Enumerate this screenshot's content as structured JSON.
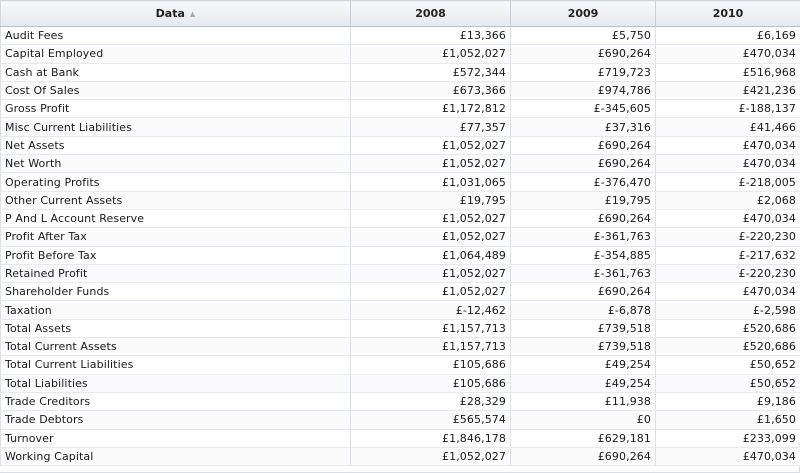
{
  "table": {
    "columns": [
      "Data",
      "2008",
      "2009",
      "2010"
    ],
    "sorted_column_icon": "sort-ascending-icon",
    "rows": [
      [
        "Audit Fees",
        "£13,366",
        "£5,750",
        "£6,169"
      ],
      [
        "Capital Employed",
        "£1,052,027",
        "£690,264",
        "£470,034"
      ],
      [
        "Cash at Bank",
        "£572,344",
        "£719,723",
        "£516,968"
      ],
      [
        "Cost Of Sales",
        "£673,366",
        "£974,786",
        "£421,236"
      ],
      [
        "Gross Profit",
        "£1,172,812",
        "£-345,605",
        "£-188,137"
      ],
      [
        "Misc Current Liabilities",
        "£77,357",
        "£37,316",
        "£41,466"
      ],
      [
        "Net Assets",
        "£1,052,027",
        "£690,264",
        "£470,034"
      ],
      [
        "Net Worth",
        "£1,052,027",
        "£690,264",
        "£470,034"
      ],
      [
        "Operating Profits",
        "£1,031,065",
        "£-376,470",
        "£-218,005"
      ],
      [
        "Other Current Assets",
        "£19,795",
        "£19,795",
        "£2,068"
      ],
      [
        "P And L Account Reserve",
        "£1,052,027",
        "£690,264",
        "£470,034"
      ],
      [
        "Profit After Tax",
        "£1,052,027",
        "£-361,763",
        "£-220,230"
      ],
      [
        "Profit Before Tax",
        "£1,064,489",
        "£-354,885",
        "£-217,632"
      ],
      [
        "Retained Profit",
        "£1,052,027",
        "£-361,763",
        "£-220,230"
      ],
      [
        "Shareholder Funds",
        "£1,052,027",
        "£690,264",
        "£470,034"
      ],
      [
        "Taxation",
        "£-12,462",
        "£-6,878",
        "£-2,598"
      ],
      [
        "Total Assets",
        "£1,157,713",
        "£739,518",
        "£520,686"
      ],
      [
        "Total Current Assets",
        "£1,157,713",
        "£739,518",
        "£520,686"
      ],
      [
        "Total Current Liabilities",
        "£105,686",
        "£49,254",
        "£50,652"
      ],
      [
        "Total Liabilities",
        "£105,686",
        "£49,254",
        "£50,652"
      ],
      [
        "Trade Creditors",
        "£28,329",
        "£11,938",
        "£9,186"
      ],
      [
        "Trade Debtors",
        "£565,574",
        "£0",
        "£1,650"
      ],
      [
        "Turnover",
        "£1,846,178",
        "£629,181",
        "£233,099"
      ],
      [
        "Working Capital",
        "£1,052,027",
        "£690,264",
        "£470,034"
      ]
    ]
  }
}
